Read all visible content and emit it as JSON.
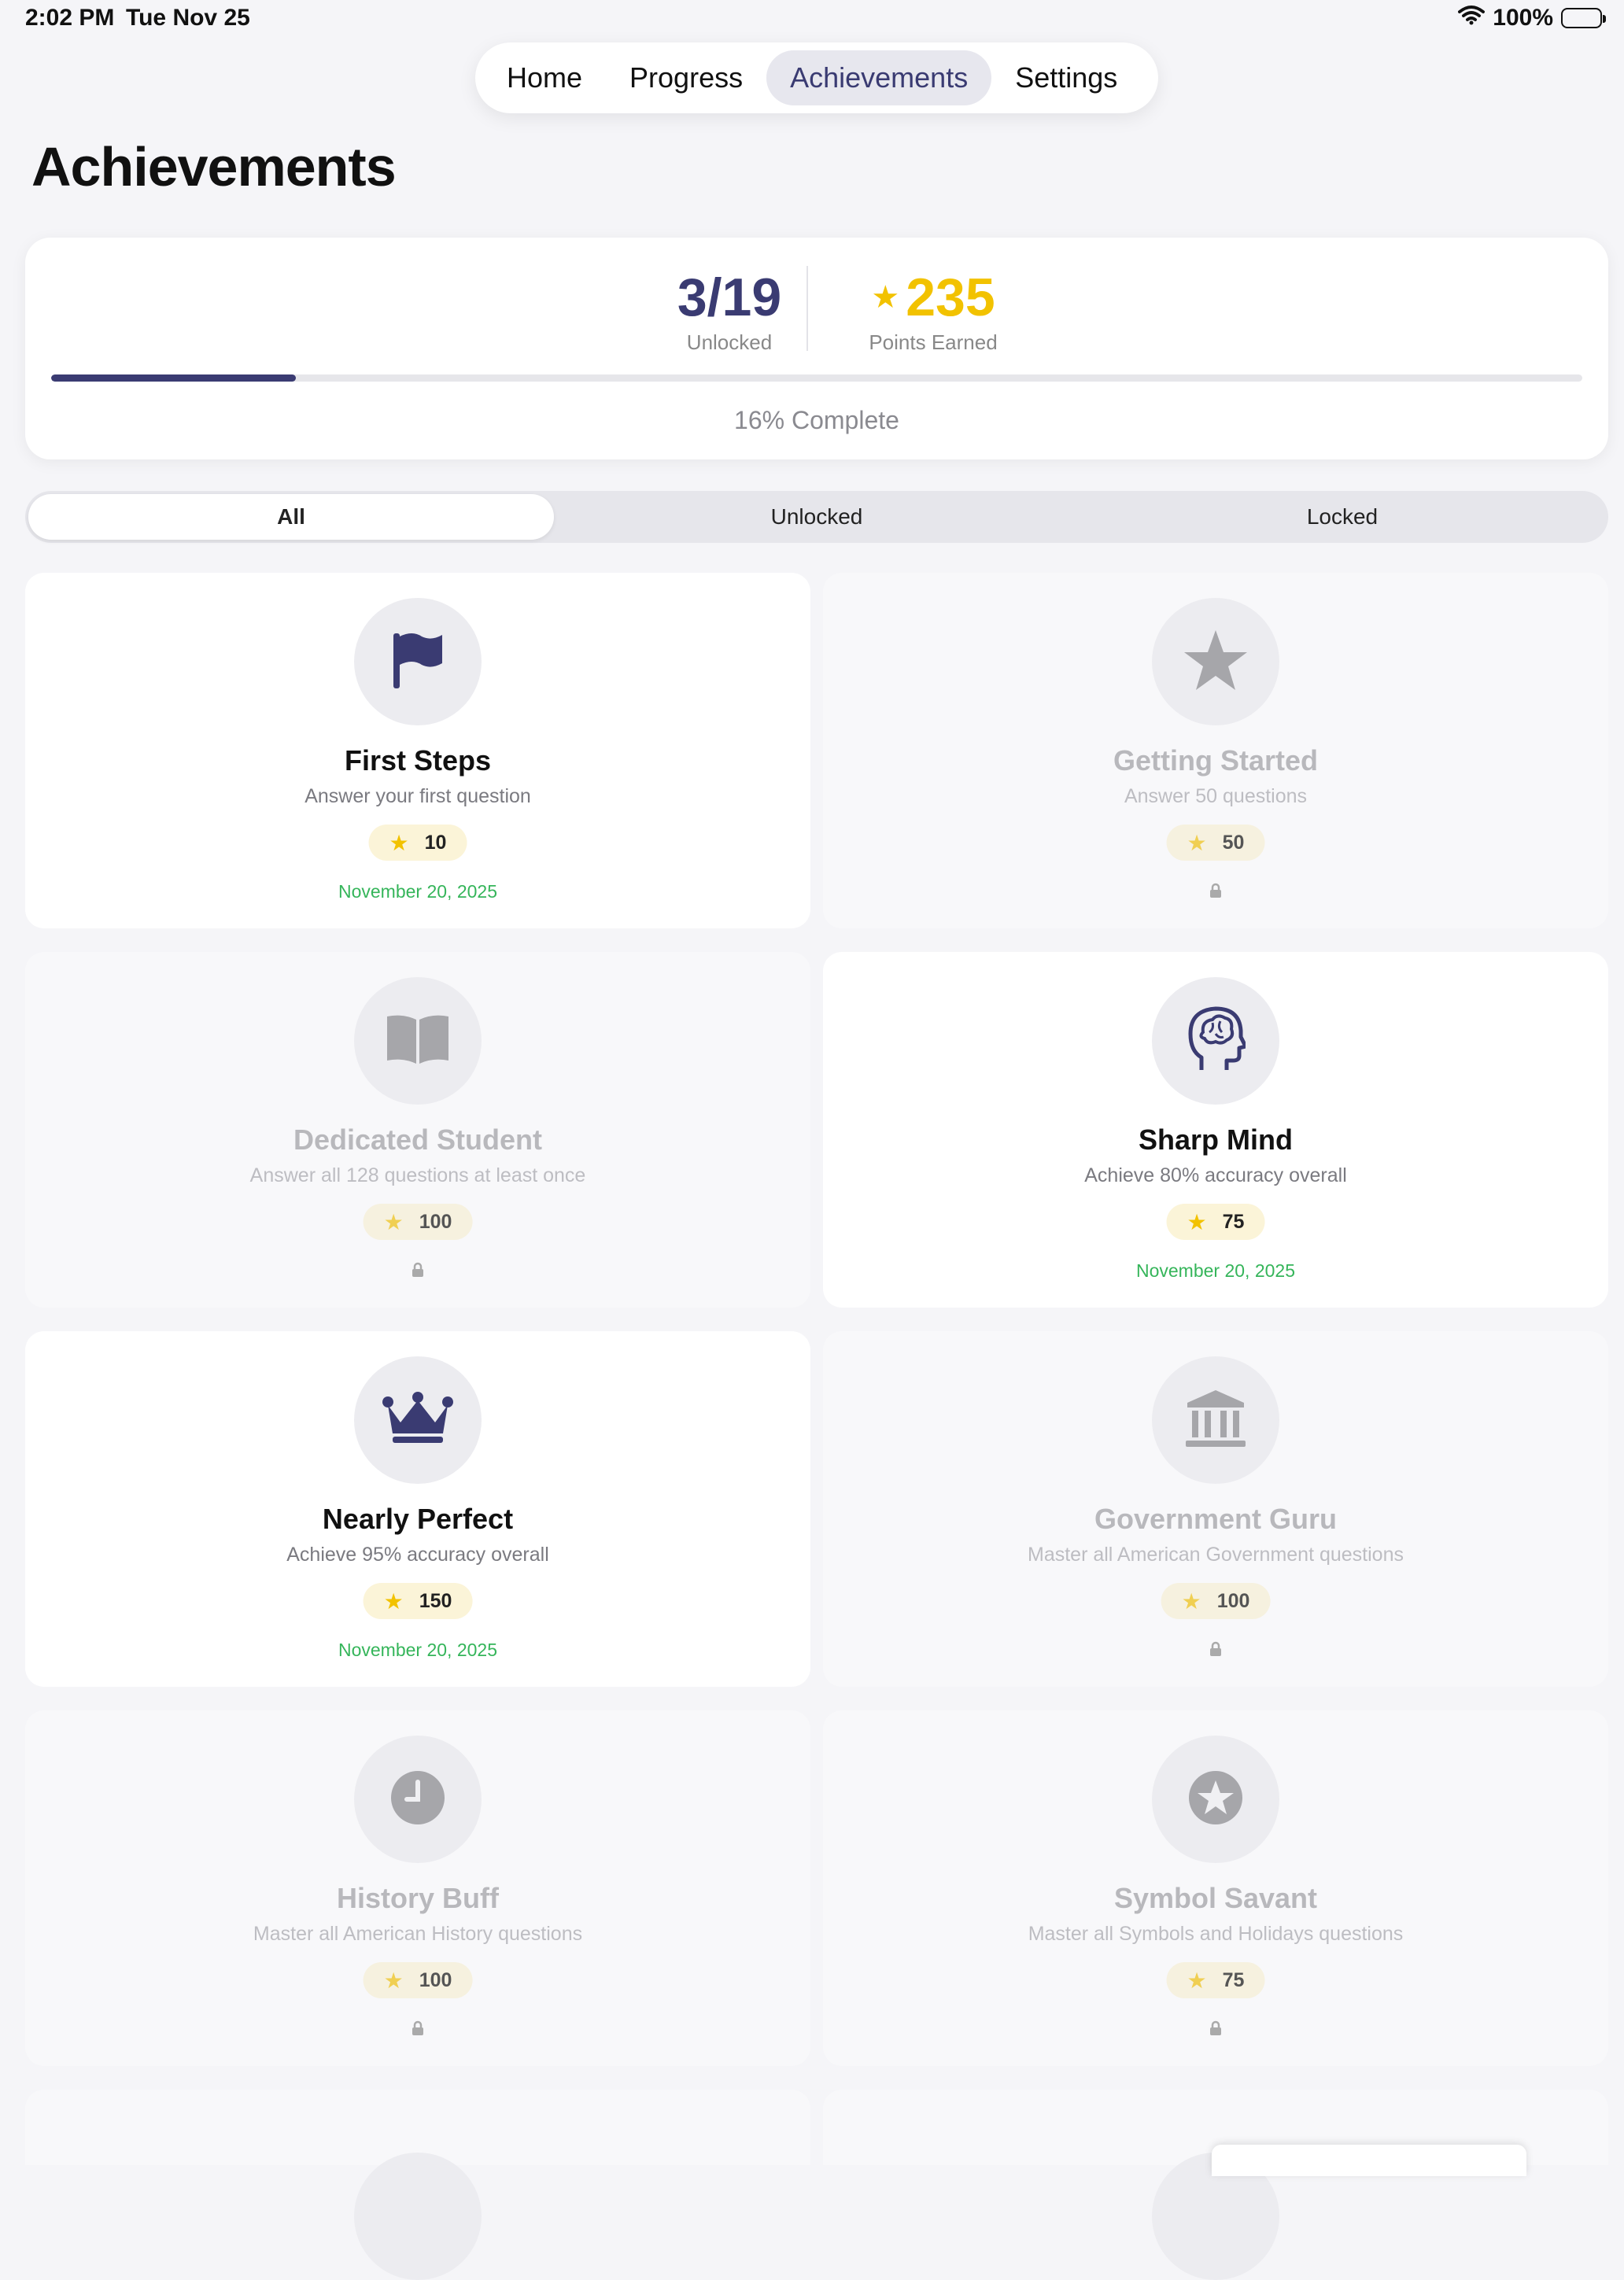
{
  "status_bar": {
    "time": "2:02 PM",
    "date": "Tue Nov 25",
    "battery": "100%",
    "icons": [
      "wifi-icon",
      "battery-icon"
    ]
  },
  "nav": {
    "tabs": [
      {
        "label": "Home"
      },
      {
        "label": "Progress"
      },
      {
        "label": "Achievements",
        "active": true
      },
      {
        "label": "Settings"
      }
    ]
  },
  "page": {
    "title": "Achievements"
  },
  "summary": {
    "unlocked_value": "3/19",
    "unlocked_label": "Unlocked",
    "points_value": "235",
    "points_label": "Points Earned",
    "progress_fraction": 0.16,
    "progress_text": "16% Complete"
  },
  "filter": {
    "tabs": [
      {
        "label": "All",
        "active": true
      },
      {
        "label": "Unlocked"
      },
      {
        "label": "Locked"
      }
    ]
  },
  "achievements": [
    {
      "title": "First Steps",
      "desc": "Answer your first question",
      "points": "10",
      "date": "November 20, 2025",
      "unlocked": true,
      "icon": "flag-icon"
    },
    {
      "title": "Getting Started",
      "desc": "Answer 50 questions",
      "points": "50",
      "unlocked": false,
      "icon": "star-icon"
    },
    {
      "title": "Dedicated Student",
      "desc": "Answer all 128 questions at least once",
      "points": "100",
      "unlocked": false,
      "icon": "book-icon"
    },
    {
      "title": "Sharp Mind",
      "desc": "Achieve 80% accuracy overall",
      "points": "75",
      "date": "November 20, 2025",
      "unlocked": true,
      "icon": "brain-head-icon"
    },
    {
      "title": "Nearly Perfect",
      "desc": "Achieve 95% accuracy overall",
      "points": "150",
      "date": "November 20, 2025",
      "unlocked": true,
      "icon": "crown-icon"
    },
    {
      "title": "Government Guru",
      "desc": "Master all American Government questions",
      "points": "100",
      "unlocked": false,
      "icon": "building-columns-icon"
    },
    {
      "title": "History Buff",
      "desc": "Master all American History questions",
      "points": "100",
      "unlocked": false,
      "icon": "clock-icon"
    },
    {
      "title": "Symbol Savant",
      "desc": "Master all Symbols and Holidays questions",
      "points": "75",
      "unlocked": false,
      "icon": "star-circle-icon"
    }
  ],
  "colors": {
    "accent": "#3a3b72",
    "gold": "#f2c200",
    "success": "#35b55a",
    "background": "#f5f5f8"
  }
}
